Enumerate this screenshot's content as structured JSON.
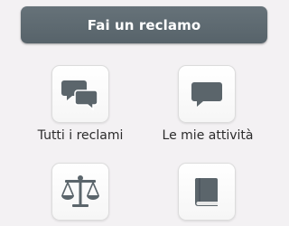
{
  "header": {
    "report_button_label": "Fai un reclamo"
  },
  "menu": {
    "items": [
      {
        "label": "Tutti i reclami",
        "icon": "speech-bubbles-icon"
      },
      {
        "label": "Le mie attività",
        "icon": "speech-bubble-icon"
      },
      {
        "label": "",
        "icon": "scales-of-justice-icon"
      },
      {
        "label": "",
        "icon": "book-icon"
      }
    ]
  },
  "colors": {
    "button_bg": "#5f6b72",
    "icon": "#5b656b",
    "background": "#f3f1f3"
  }
}
